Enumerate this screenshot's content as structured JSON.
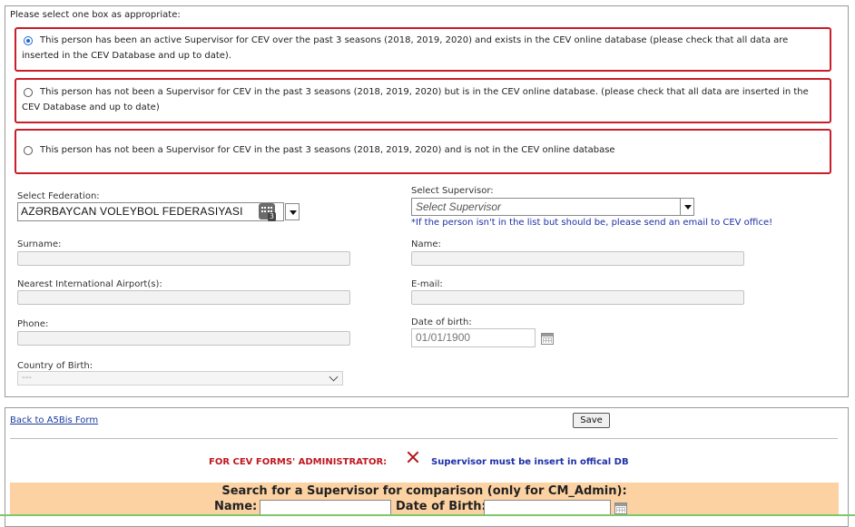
{
  "intro": "Please select one box as appropriate:",
  "options": [
    {
      "text": "This person has been an active Supervisor for CEV over the past 3 seasons (2018, 2019, 2020) and exists in the CEV online database (please check that all data are inserted in the CEV Database and up to date).",
      "selected": true
    },
    {
      "text": "This person has not been a Supervisor for CEV in the past 3 seasons (2018, 2019, 2020) but is in the CEV online database. (please check that all data are inserted in the CEV Database and up to date)",
      "selected": false
    },
    {
      "text": "This person has not been a Supervisor for CEV in the past 3 seasons (2018, 2019, 2020) and is not in the CEV online database",
      "selected": false
    }
  ],
  "form": {
    "federation_label": "Select Federation:",
    "federation_value": "AZƏRBAYCAN VOLEYBOL FEDERASIYASI",
    "federation_badge": "3",
    "supervisor_label": "Select Supervisor:",
    "supervisor_placeholder": "Select Supervisor",
    "supervisor_note": "*If the person isn't in the list but should be, please send an email to CEV office!",
    "surname_label": "Surname:",
    "name_label": "Name:",
    "airport_label": "Nearest International Airport(s):",
    "email_label": "E-mail:",
    "phone_label": "Phone:",
    "dob_label": "Date of birth:",
    "dob_value": "01/01/1900",
    "country_label": "Country of Birth:",
    "country_value": "---"
  },
  "footer": {
    "back_link": "Back to A5Bis Form",
    "save_button": "Save",
    "admin_label": "FOR CEV FORMS' ADMINISTRATOR:",
    "admin_message": "Supervisor must be insert in offical DB"
  },
  "search": {
    "title": "Search for a Supervisor for comparison (only for CM_Admin):",
    "name_label": "Name:",
    "dob_label": "Date of Birth:"
  },
  "colors": {
    "option_border": "#c81e2a",
    "note_blue": "#1d2fa8",
    "admin_red": "#c0161e",
    "search_bg": "#fcd2a3"
  },
  "icons": [
    "radio-selected-icon",
    "radio-icon",
    "federation-badge-icon",
    "dropdown-arrow-icon",
    "calendar-icon",
    "chevron-down-icon",
    "close-x-icon"
  ]
}
